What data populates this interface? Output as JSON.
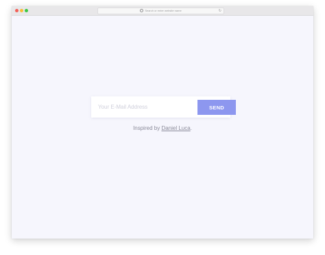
{
  "browser": {
    "address_bar_placeholder": "Search or enter website name",
    "icons": [
      "close-button",
      "minimize-button",
      "maximize-button",
      "search-icon",
      "reload-icon"
    ]
  },
  "form": {
    "email_placeholder": "Your E-Mail Address",
    "send_label": "SEND"
  },
  "credit": {
    "prefix": "Inspired by",
    "author": "Daniel Luca",
    "suffix": "."
  },
  "colors": {
    "page_background": "#f6f6fd",
    "button": "#8d97ef",
    "button_text": "#ffffff",
    "text_muted": "#8a8a99"
  }
}
